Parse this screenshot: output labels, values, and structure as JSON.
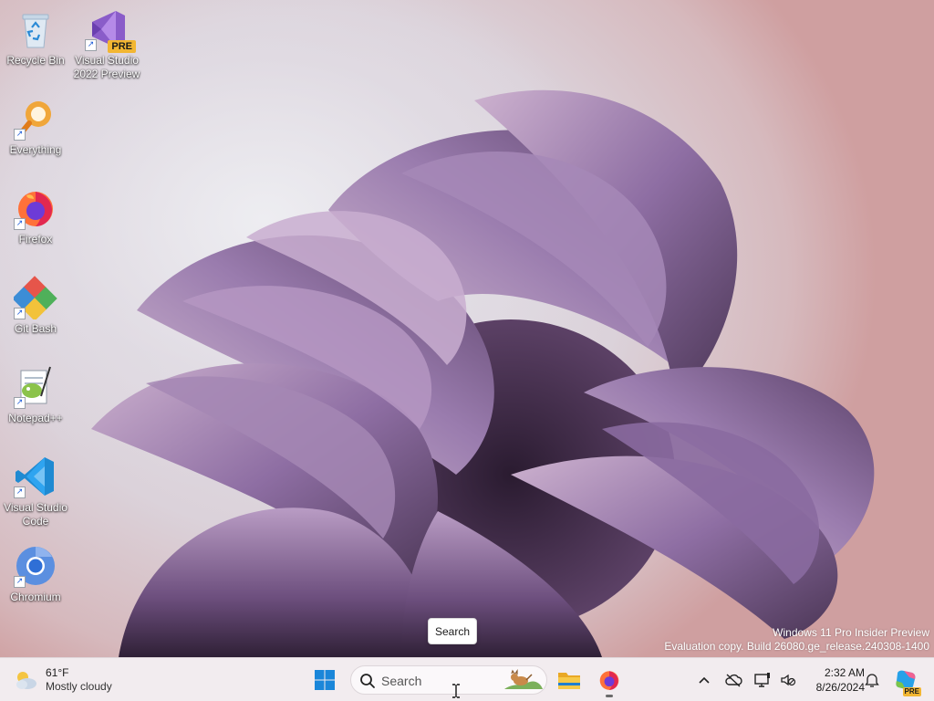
{
  "desktop": {
    "icons": [
      {
        "label": "Recycle Bin",
        "icon": "recycle-bin-icon"
      },
      {
        "label": "Visual Studio 2022 Preview",
        "icon": "visual-studio-preview-icon",
        "badge": "PRE"
      },
      {
        "label": "Everything",
        "icon": "everything-search-icon"
      },
      {
        "label": "Firefox",
        "icon": "firefox-icon"
      },
      {
        "label": "Git Bash",
        "icon": "git-bash-icon"
      },
      {
        "label": "Notepad++",
        "icon": "notepad-plus-plus-icon"
      },
      {
        "label": "Visual Studio Code",
        "icon": "vscode-icon"
      },
      {
        "label": "Chromium",
        "icon": "chromium-icon"
      }
    ],
    "watermark": {
      "line1": "Windows 11 Pro Insider Preview",
      "line2": "Evaluation copy. Build 26080.ge_release.240308-1400"
    },
    "tooltip": "Search"
  },
  "taskbar": {
    "weather": {
      "temp": "61°F",
      "condition": "Mostly cloudy",
      "icon": "partly-cloudy-icon"
    },
    "start_icon": "windows-start-icon",
    "search": {
      "placeholder": "Search",
      "icon": "search-icon"
    },
    "pinned": [
      {
        "name": "File Explorer",
        "icon": "folder-icon"
      },
      {
        "name": "Firefox",
        "icon": "firefox-icon",
        "active": true
      }
    ],
    "tray": {
      "overflow_icon": "chevron-up-icon",
      "clock": {
        "time": "2:32 AM",
        "date": "8/26/2024"
      }
    },
    "copilot_badge": "PRE"
  },
  "colors": {
    "taskbar_bg": "#f2ecef",
    "wallpaper_purple": "#8d6a9c",
    "accent_blue": "#0067c0"
  }
}
